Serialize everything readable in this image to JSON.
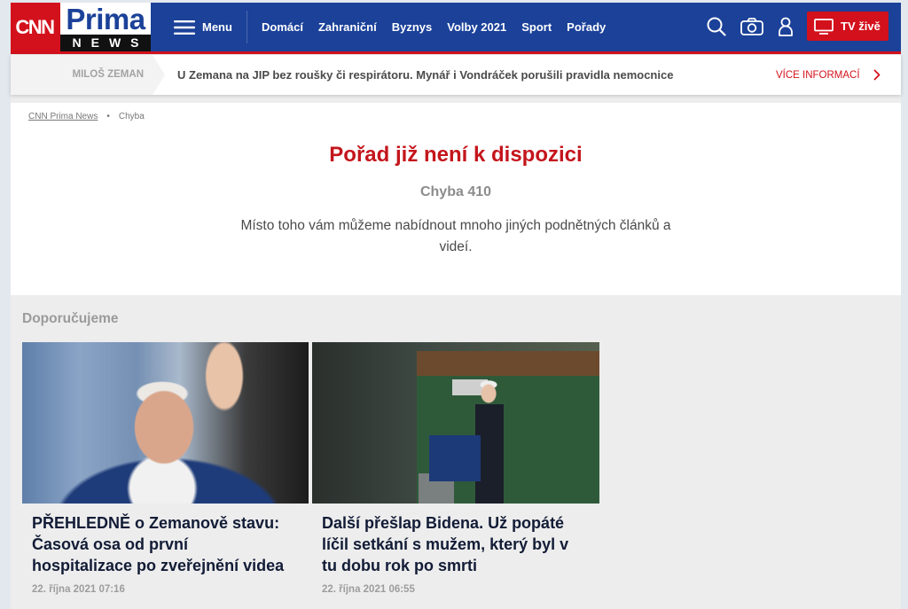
{
  "header": {
    "logo": {
      "cnn": "CNN",
      "prima": "Prima",
      "news": "NEWS"
    },
    "menu_label": "Menu",
    "nav": [
      {
        "label": "Domácí"
      },
      {
        "label": "Zahraniční"
      },
      {
        "label": "Byznys"
      },
      {
        "label": "Volby 2021"
      },
      {
        "label": "Sport"
      },
      {
        "label": "Pořady"
      }
    ],
    "icons": {
      "menu": "hamburger-icon",
      "search": "search-icon",
      "camera": "camera-icon",
      "user": "user-icon",
      "tv": "tv-icon"
    },
    "live_button_label": "TV živě"
  },
  "breaking": {
    "tag": "MILOŠ ZEMAN",
    "headline": "U Zemana na JIP bez roušky či respirátoru. Mynář i Vondráček porušili pravidla nemocnice",
    "more_label": "VÍCE INFORMACÍ",
    "more_icon": "chevron-right-icon"
  },
  "breadcrumb": {
    "home": "CNN Prima News",
    "separator": "•",
    "current": "Chyba"
  },
  "error": {
    "title": "Pořad již není k dispozici",
    "code": "Chyba 410",
    "message": "Místo toho vám můžeme nabídnout mnoho jiných podnětných článků a videí."
  },
  "recommended": {
    "heading": "Doporučujeme",
    "articles": [
      {
        "title": "PŘEHLEDNĚ o Zemanově stavu: Časová osa od první hospitalizace po zveřejnění videa",
        "date": "22. října 2021 07:16"
      },
      {
        "title": "Další přešlap Bidena. Už popáté líčil setkání s mužem, který byl v tu dobu rok po smrti",
        "date": "22. října 2021 06:55"
      }
    ]
  },
  "colors": {
    "header_blue": "#1b4199",
    "brand_red": "#d3111c",
    "title_red": "#c4151c",
    "headline_navy": "#121c36"
  }
}
